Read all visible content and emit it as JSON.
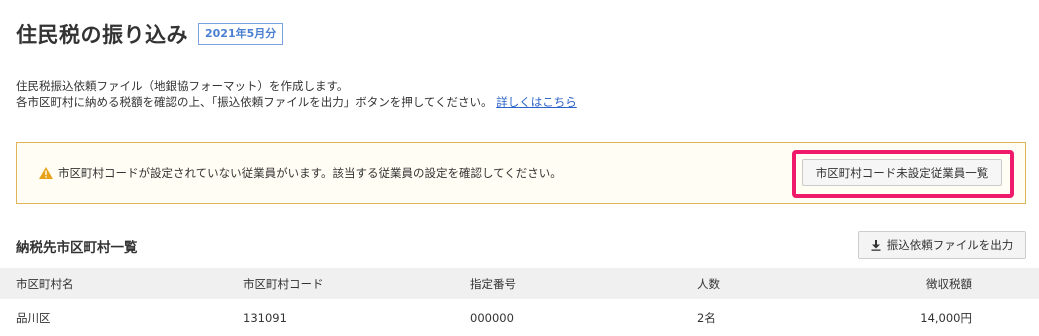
{
  "header": {
    "title": "住民税の振り込み",
    "period_badge": "2021年5月分"
  },
  "description": {
    "line1": "住民税振込依頼ファイル（地銀協フォーマット）を作成します。",
    "line2": "各市区町村に納める税額を確認の上、「振込依頼ファイルを出力」ボタンを押してください。",
    "help_link": "詳しくはこちら"
  },
  "alert": {
    "icon": "warning-triangle-icon",
    "icon_color": "#e8a21a",
    "message": "市区町村コードが設定されていない従業員がいます。該当する従業員の設定を確認してください。",
    "button_label": "市区町村コード未設定従業員一覧",
    "highlight_color": "#ef1b6a"
  },
  "section": {
    "title": "納税先市区町村一覧",
    "export_icon": "download-icon",
    "export_button_label": "振込依頼ファイルを出力"
  },
  "table": {
    "columns": [
      "市区町村名",
      "市区町村コード",
      "指定番号",
      "人数",
      "徴収税額"
    ],
    "rows": [
      [
        "品川区",
        "131091",
        "000000",
        "2名",
        "14,000円"
      ]
    ]
  }
}
